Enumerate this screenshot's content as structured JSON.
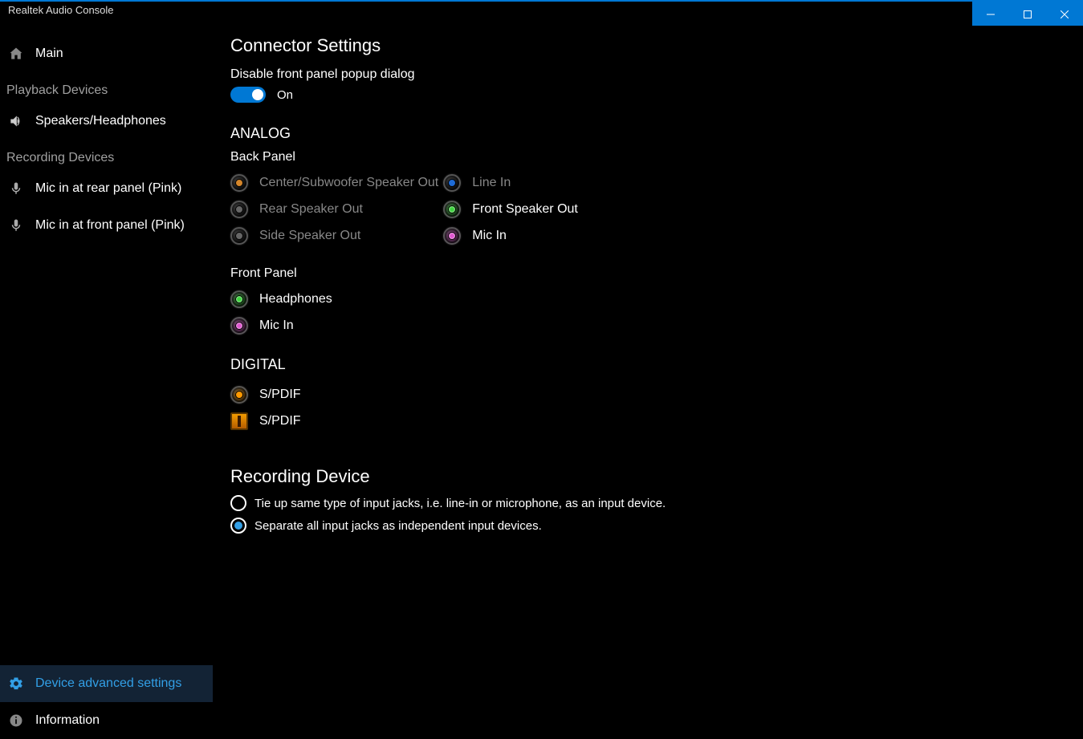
{
  "window": {
    "title": "Realtek Audio Console"
  },
  "sidebar": {
    "main_label": "Main",
    "playback_section": "Playback Devices",
    "playback_items": [
      {
        "label": "Speakers/Headphones"
      }
    ],
    "recording_section": "Recording Devices",
    "recording_items": [
      {
        "label": "Mic in at rear panel (Pink)"
      },
      {
        "label": "Mic in at front panel (Pink)"
      }
    ],
    "footer": {
      "advanced_label": "Device advanced settings",
      "information_label": "Information"
    }
  },
  "content": {
    "connector_title": "Connector Settings",
    "disable_popup_label": "Disable front panel popup dialog",
    "toggle_state_label": "On",
    "analog_title": "ANALOG",
    "back_panel_label": "Back Panel",
    "back_panel_left": [
      {
        "label": "Center/Subwoofer Speaker Out",
        "color": "#d4862a",
        "active": false
      },
      {
        "label": "Rear Speaker Out",
        "color": "#666",
        "active": false
      },
      {
        "label": "Side Speaker Out",
        "color": "#666",
        "active": false
      }
    ],
    "back_panel_right": [
      {
        "label": "Line In",
        "color": "#1e6bd6",
        "active": false
      },
      {
        "label": "Front Speaker Out",
        "color": "#3cd63c",
        "active": true
      },
      {
        "label": "Mic In",
        "color": "#e055d0",
        "active": true
      }
    ],
    "front_panel_label": "Front Panel",
    "front_panel": [
      {
        "label": "Headphones",
        "color": "#3cd63c",
        "active": true
      },
      {
        "label": "Mic In",
        "color": "#e055d0",
        "active": true
      }
    ],
    "digital_title": "DIGITAL",
    "digital_items": [
      {
        "label": "S/PDIF",
        "type": "coax",
        "color": "#ff9a00"
      },
      {
        "label": "S/PDIF",
        "type": "optical"
      }
    ],
    "recording_title": "Recording Device",
    "recording_options": [
      {
        "label": "Tie up same type of input jacks, i.e. line-in or microphone, as an input device.",
        "selected": false
      },
      {
        "label": "Separate all input jacks as independent input devices.",
        "selected": true
      }
    ]
  }
}
